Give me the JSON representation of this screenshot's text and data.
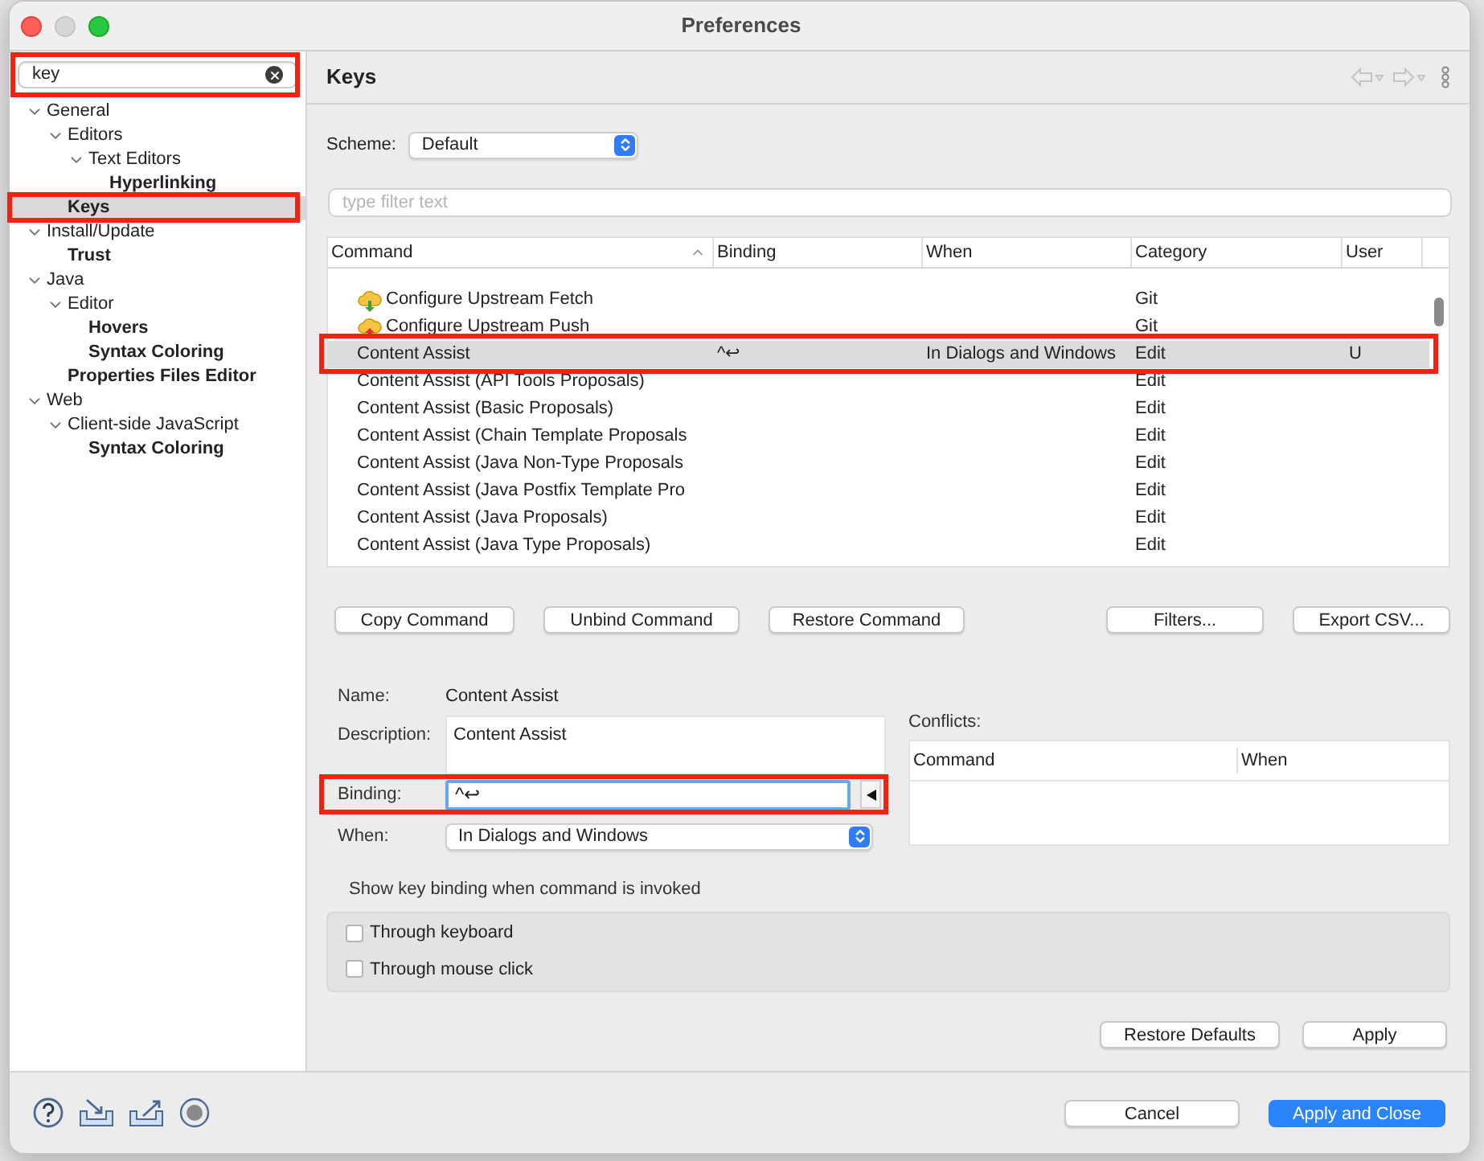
{
  "window": {
    "title": "Preferences"
  },
  "sidebar": {
    "search": {
      "value": "key"
    },
    "tree": [
      {
        "label": "General",
        "expanded": true,
        "matched": false,
        "selected": false,
        "children": [
          {
            "label": "Editors",
            "expanded": true,
            "matched": false,
            "selected": false,
            "children": [
              {
                "label": "Text Editors",
                "expanded": true,
                "matched": false,
                "selected": false,
                "children": [
                  {
                    "label": "Hyperlinking",
                    "matched": true,
                    "selected": false
                  }
                ]
              }
            ]
          },
          {
            "label": "Keys",
            "matched": true,
            "selected": true
          }
        ]
      },
      {
        "label": "Install/Update",
        "expanded": true,
        "matched": false,
        "selected": false,
        "children": [
          {
            "label": "Trust",
            "matched": true,
            "selected": false
          }
        ]
      },
      {
        "label": "Java",
        "expanded": true,
        "matched": false,
        "selected": false,
        "children": [
          {
            "label": "Editor",
            "expanded": true,
            "matched": false,
            "selected": false,
            "children": [
              {
                "label": "Hovers",
                "matched": true,
                "selected": false
              },
              {
                "label": "Syntax Coloring",
                "matched": true,
                "selected": false
              }
            ]
          },
          {
            "label": "Properties Files Editor",
            "matched": true,
            "selected": false
          }
        ]
      },
      {
        "label": "Web",
        "expanded": true,
        "matched": false,
        "selected": false,
        "children": [
          {
            "label": "Client-side JavaScript",
            "expanded": true,
            "matched": false,
            "selected": false,
            "children": [
              {
                "label": "Syntax Coloring",
                "matched": true,
                "selected": false
              }
            ]
          }
        ]
      }
    ]
  },
  "page": {
    "title": "Keys",
    "scheme": {
      "label": "Scheme:",
      "value": "Default"
    },
    "filter": {
      "placeholder": "type filter text"
    },
    "table": {
      "columns": [
        "Command",
        "Binding",
        "When",
        "Category",
        "User"
      ],
      "rows": [
        {
          "kind": "fetch",
          "command": "Configure Upstream Fetch",
          "binding": "",
          "when": "",
          "category": "Git",
          "user": "",
          "selected": false
        },
        {
          "kind": "push",
          "command": "Configure Upstream Push",
          "binding": "",
          "when": "",
          "category": "Git",
          "user": "",
          "selected": false
        },
        {
          "kind": "plain",
          "command": "Content Assist",
          "binding": "^↩",
          "when": "In Dialogs and Windows",
          "category": "Edit",
          "user": "U",
          "selected": true
        },
        {
          "kind": "plain",
          "command": "Content Assist (API Tools Proposals)",
          "binding": "",
          "when": "",
          "category": "Edit",
          "user": "",
          "selected": false
        },
        {
          "kind": "plain",
          "command": "Content Assist (Basic Proposals)",
          "binding": "",
          "when": "",
          "category": "Edit",
          "user": "",
          "selected": false
        },
        {
          "kind": "plain",
          "command": "Content Assist (Chain Template Proposals",
          "binding": "",
          "when": "",
          "category": "Edit",
          "user": "",
          "selected": false
        },
        {
          "kind": "plain",
          "command": "Content Assist (Java Non-Type Proposals",
          "binding": "",
          "when": "",
          "category": "Edit",
          "user": "",
          "selected": false
        },
        {
          "kind": "plain",
          "command": "Content Assist (Java Postfix Template Pro",
          "binding": "",
          "when": "",
          "category": "Edit",
          "user": "",
          "selected": false
        },
        {
          "kind": "plain",
          "command": "Content Assist (Java Proposals)",
          "binding": "",
          "when": "",
          "category": "Edit",
          "user": "",
          "selected": false
        },
        {
          "kind": "plain",
          "command": "Content Assist (Java Type Proposals)",
          "binding": "",
          "when": "",
          "category": "Edit",
          "user": "",
          "selected": false
        }
      ]
    },
    "command_buttons": [
      "Copy Command",
      "Unbind Command",
      "Restore Command"
    ],
    "side_buttons": [
      "Filters...",
      "Export CSV..."
    ],
    "details": {
      "name_label": "Name:",
      "name": "Content Assist",
      "description_label": "Description:",
      "description": "Content Assist",
      "binding_label": "Binding:",
      "binding": "^↩",
      "when_label": "When:",
      "when": "In Dialogs and Windows"
    },
    "conflicts": {
      "label": "Conflicts:",
      "columns": [
        "Command",
        "When"
      ]
    },
    "show_binding": {
      "label": "Show key binding when command is invoked",
      "options": [
        {
          "label": "Through keyboard",
          "checked": false
        },
        {
          "label": "Through mouse click",
          "checked": false
        }
      ]
    },
    "page_buttons": [
      "Restore Defaults",
      "Apply"
    ]
  },
  "footer": {
    "buttons": [
      {
        "label": "Cancel",
        "primary": false
      },
      {
        "label": "Apply and Close",
        "primary": true
      }
    ]
  }
}
